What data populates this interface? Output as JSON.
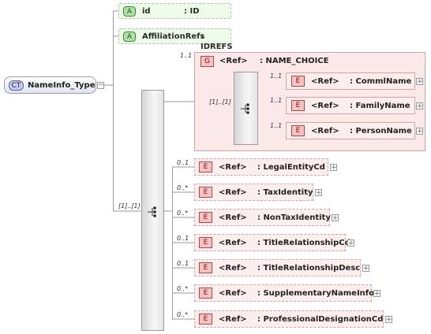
{
  "complex_type": {
    "badge": "CT",
    "name": "NameInfo_Type"
  },
  "attributes": [
    {
      "badge": "A",
      "name": "id",
      "type": ": ID"
    },
    {
      "badge": "A",
      "name": "AffiliationRefs",
      "type": ": IDREFS"
    }
  ],
  "sequence": {
    "cardinality": "[1]..[1]"
  },
  "choice_group": {
    "cardinality": "1..1",
    "badge": "G",
    "ref": "<Ref>",
    "name": ": NAME_CHOICE",
    "inner_cardinality": "[1]..[1]",
    "elements": [
      {
        "badge": "E",
        "ref": "<Ref>",
        "name": ": CommlName",
        "cardinality": "1..1"
      },
      {
        "badge": "E",
        "ref": "<Ref>",
        "name": ": FamilyName",
        "cardinality": "1..1"
      },
      {
        "badge": "E",
        "ref": "<Ref>",
        "name": ": PersonName",
        "cardinality": "1..1"
      }
    ]
  },
  "elements": [
    {
      "badge": "E",
      "ref": "<Ref>",
      "name": ": LegalEntityCd",
      "cardinality": "0..1"
    },
    {
      "badge": "E",
      "ref": "<Ref>",
      "name": ": TaxIdentity",
      "cardinality": "0..*"
    },
    {
      "badge": "E",
      "ref": "<Ref>",
      "name": ": NonTaxIdentity",
      "cardinality": "0..*"
    },
    {
      "badge": "E",
      "ref": "<Ref>",
      "name": ": TitleRelationshipCd",
      "cardinality": "0..1"
    },
    {
      "badge": "E",
      "ref": "<Ref>",
      "name": ": TitleRelationshipDesc",
      "cardinality": "0..1"
    },
    {
      "badge": "E",
      "ref": "<Ref>",
      "name": ": SupplementaryNameInfo",
      "cardinality": "0..*"
    },
    {
      "badge": "E",
      "ref": "<Ref>",
      "name": ": ProfessionalDesignationCd",
      "cardinality": "0..*"
    }
  ],
  "icons": {
    "expand": "plus-icon",
    "collapse": "minus-icon",
    "sequence": "sequence-icon"
  },
  "colors": {
    "element_fill": "#fdeeee",
    "attribute_fill": "#eefbe9",
    "complex_type_badge": "#c8cbf0"
  }
}
